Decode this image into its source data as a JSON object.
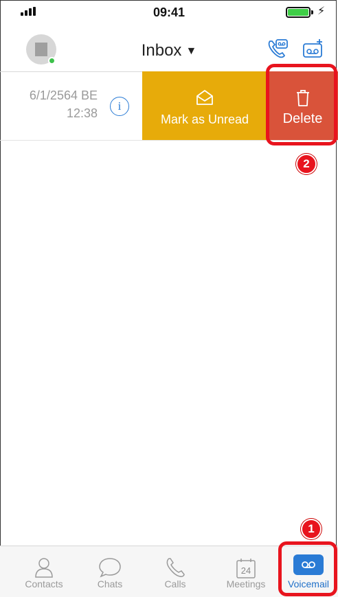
{
  "status_bar": {
    "time": "09:41"
  },
  "header": {
    "title": "Inbox"
  },
  "voicemail_row": {
    "date": "6/1/2564 BE",
    "time": "12:38",
    "info_glyph": "i",
    "actions": {
      "mark_unread": "Mark as Unread",
      "delete": "Delete"
    }
  },
  "callouts": {
    "step1": "1",
    "step2": "2",
    "color": "#e8141e"
  },
  "tabs": [
    {
      "label": "Contacts",
      "icon": "contacts-icon"
    },
    {
      "label": "Chats",
      "icon": "chats-icon"
    },
    {
      "label": "Calls",
      "icon": "calls-icon"
    },
    {
      "label": "Meetings",
      "icon": "meetings-calendar-icon",
      "day": "24"
    },
    {
      "label": "Voicemail",
      "icon": "voicemail-icon",
      "active": true
    }
  ],
  "colors": {
    "accent": "#2a7bd5",
    "mark_unread_bg": "#e7ab0a",
    "delete_bg": "#d9533a",
    "presence": "#3cc14b"
  }
}
